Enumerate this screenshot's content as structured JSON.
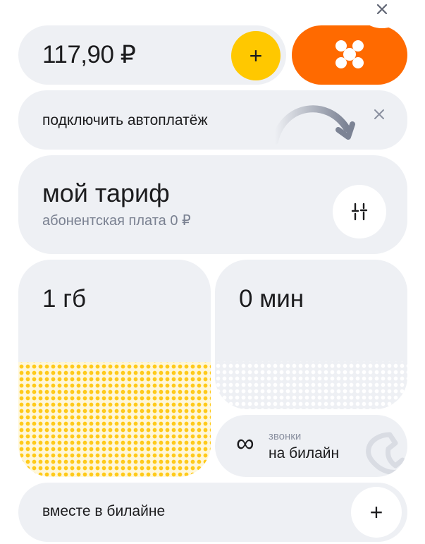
{
  "balance": {
    "amount": "117,90 ₽",
    "topup_icon": "plus-icon"
  },
  "brand": {
    "logo_icon": "beeline-logo-icon",
    "color": "#ff6a00"
  },
  "autopay": {
    "label": "подключить автоплатёж"
  },
  "tariff": {
    "title": "мой тариф",
    "subtitle": "абонентская плата 0 ₽"
  },
  "internet": {
    "value": "1 гб",
    "fill_level": 0.53,
    "color": "#ffca1a"
  },
  "minutes": {
    "value": "0 мин",
    "fill_level": 0.32
  },
  "calls": {
    "symbol": "∞",
    "small_label": "звонки",
    "label": "на билайн"
  },
  "together": {
    "label": "вместе в билайне"
  },
  "colors": {
    "accent_yellow": "#ffc800",
    "accent_orange": "#ff6a00",
    "card": "#eef0f4"
  }
}
